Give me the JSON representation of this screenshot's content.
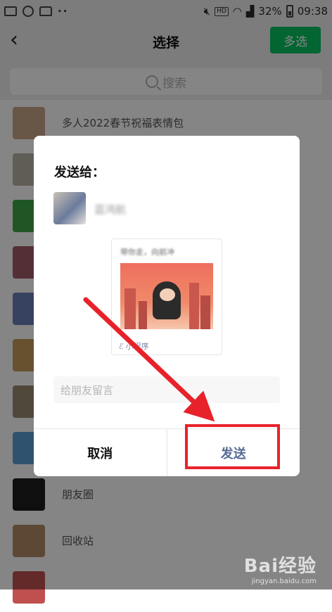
{
  "status_bar": {
    "notification_dots": "··",
    "network_badge": "HD",
    "battery_percent": "32%",
    "time": "09:38",
    "icons": [
      "image-icon",
      "photo-icon",
      "bag-icon",
      "mute-icon",
      "wifi-icon",
      "signal-icon",
      "battery-icon"
    ]
  },
  "header": {
    "back_icon": "chevron-left-icon",
    "title": "选择",
    "multi_select_label": "多选",
    "accent_color": "#07c160"
  },
  "search": {
    "placeholder": "搜索",
    "icon": "search-icon"
  },
  "chat_list": {
    "rows": [
      {
        "name": "多人2022春节祝福表情包"
      },
      {
        "name": ""
      },
      {
        "name": ""
      },
      {
        "name": ""
      },
      {
        "name": ""
      },
      {
        "name": ""
      },
      {
        "name": ""
      },
      {
        "name": ""
      },
      {
        "name": "朋友圈"
      },
      {
        "name": "回收站"
      },
      {
        "name": ""
      }
    ]
  },
  "dialog": {
    "title": "发送给：",
    "recipient_name": "蓝鸿航",
    "card": {
      "title": "带你走，向前冲",
      "footer_label": "小程序",
      "footer_icon": "mini-program-icon"
    },
    "message_placeholder": "给朋友留言",
    "cancel_label": "取消",
    "send_label": "发送",
    "send_color": "#576b95"
  },
  "annotation": {
    "color": "#e8222a"
  },
  "watermark": {
    "logo": "Bai经验",
    "url": "jingyan.baidu.com"
  }
}
